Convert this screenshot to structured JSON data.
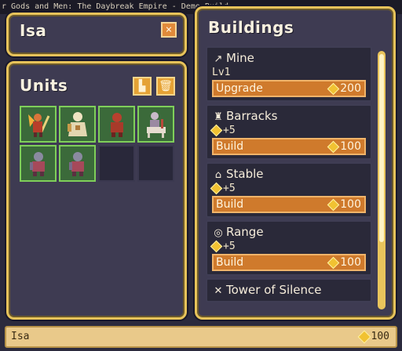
{
  "window": {
    "title": "r Gods and Men: The Daybreak Empire - Demo Build"
  },
  "location_panel": {
    "name": "Isa",
    "close_label": "×"
  },
  "units_panel": {
    "title": "Units",
    "units": [
      {
        "name": "winged-knight",
        "color": "#c2542a"
      },
      {
        "name": "robed-priest",
        "color": "#e3d6b0"
      },
      {
        "name": "red-warrior",
        "color": "#a83a2a"
      },
      {
        "name": "cavalry-rider",
        "color": "#c9b9c9"
      },
      {
        "name": "footsoldier",
        "color": "#a6495a"
      },
      {
        "name": "footsoldier",
        "color": "#a6495a"
      }
    ],
    "empty_slots": 2
  },
  "buildings_panel": {
    "title": "Buildings",
    "buildings": [
      {
        "name": "Mine",
        "icon": "pickaxe-icon",
        "glyph": "↗",
        "sub": "Lv1",
        "action": "Upgrade",
        "cost": "200"
      },
      {
        "name": "Barracks",
        "icon": "barracks-icon",
        "glyph": "♜",
        "sub": "+5",
        "action": "Build",
        "cost": "100"
      },
      {
        "name": "Stable",
        "icon": "stable-icon",
        "glyph": "⌂",
        "sub": "+5",
        "action": "Build",
        "cost": "100"
      },
      {
        "name": "Range",
        "icon": "target-icon",
        "glyph": "◎",
        "sub": "+5",
        "action": "Build",
        "cost": "100"
      },
      {
        "name": "Tower of Silence",
        "icon": "tower-icon",
        "glyph": "✕",
        "sub": "",
        "action": "",
        "cost": ""
      }
    ]
  },
  "status_bar": {
    "location": "Isa",
    "gold": "100"
  },
  "colors": {
    "accent_gold": "#e7c35a",
    "button_orange": "#cf7a2c",
    "slot_green": "#7fcf5a",
    "panel_bg": "#3e3b52"
  }
}
